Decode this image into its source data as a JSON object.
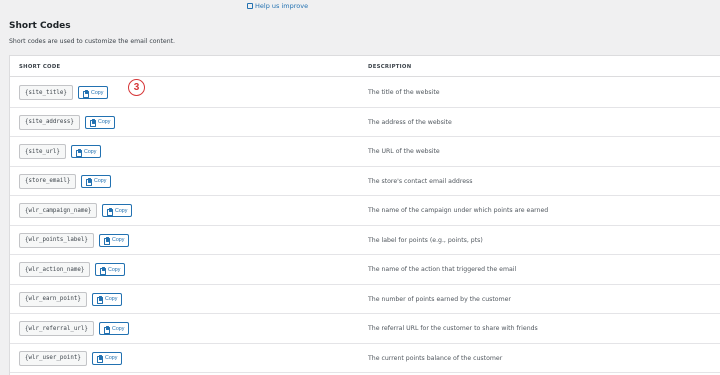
{
  "help_link": {
    "label": "Help us improve"
  },
  "section": {
    "title": "Short Codes",
    "description": "Short codes are used to customize the email content."
  },
  "table": {
    "col_code": "SHORT CODE",
    "col_desc": "DESCRIPTION",
    "copy_label": "Copy",
    "rows": [
      {
        "code": "{site_title}",
        "desc": "The title of the website"
      },
      {
        "code": "{site_address}",
        "desc": "The address of the website"
      },
      {
        "code": "{site_url}",
        "desc": "The URL of the website"
      },
      {
        "code": "{store_email}",
        "desc": "The store's contact email address"
      },
      {
        "code": "{wlr_campaign_name}",
        "desc": "The name of the campaign under which points are earned"
      },
      {
        "code": "{wlr_points_label}",
        "desc": "The label for points (e.g., points, pts)"
      },
      {
        "code": "{wlr_action_name}",
        "desc": "The name of the action that triggered the email"
      },
      {
        "code": "{wlr_earn_point}",
        "desc": "The number of points earned by the customer"
      },
      {
        "code": "{wlr_referral_url}",
        "desc": "The referral URL for the customer to share with friends"
      },
      {
        "code": "{wlr_user_point}",
        "desc": "The current points balance of the customer"
      }
    ]
  },
  "annotation": {
    "step": "3"
  },
  "colors": {
    "accent": "#2271b1",
    "badge": "#d63638",
    "background": "#f0f0f1"
  }
}
